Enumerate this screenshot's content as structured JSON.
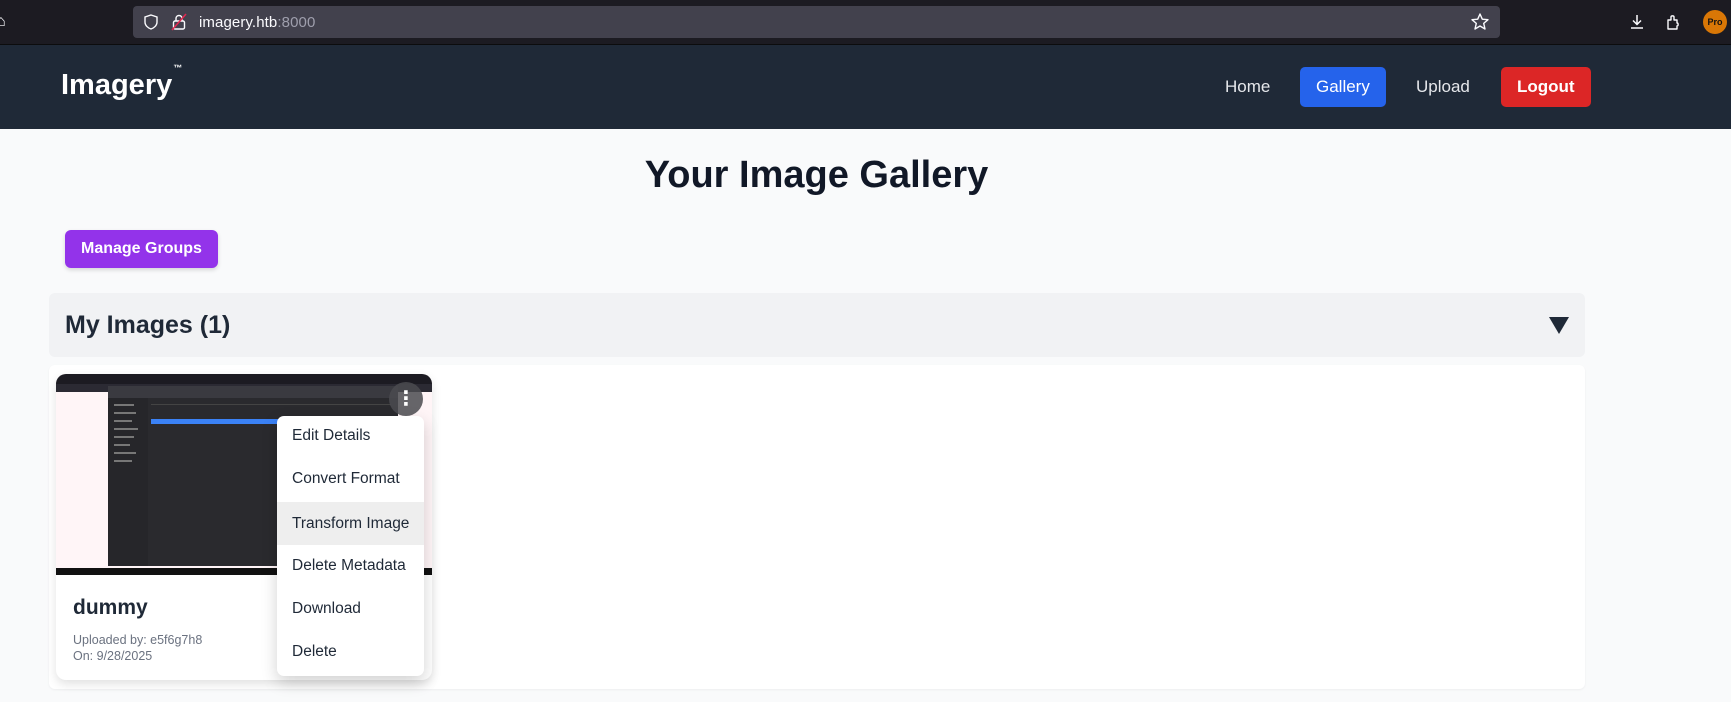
{
  "browser": {
    "url_host": "imagery.htb",
    "url_port": ":8000",
    "extension_badge": "Pro"
  },
  "nav": {
    "logo": "Imagery",
    "logo_tm": "™",
    "home": "Home",
    "gallery": "Gallery",
    "upload": "Upload",
    "logout": "Logout"
  },
  "main": {
    "title": "Your Image Gallery",
    "manage_groups": "Manage Groups",
    "group_title": "My Images (1)"
  },
  "card": {
    "name": "dummy",
    "uploaded_by": "Uploaded by: e5f6g7h8",
    "uploaded_on": "On: 9/28/2025"
  },
  "menu": {
    "items": [
      "Edit Details",
      "Convert Format",
      "Transform Image",
      "Delete Metadata",
      "Download",
      "Delete"
    ],
    "hovered_index": 2
  },
  "colors": {
    "navbar": "#1f2937",
    "gallery_active": "#2563eb",
    "logout": "#dc2626",
    "manage_groups": "#9333ea"
  }
}
